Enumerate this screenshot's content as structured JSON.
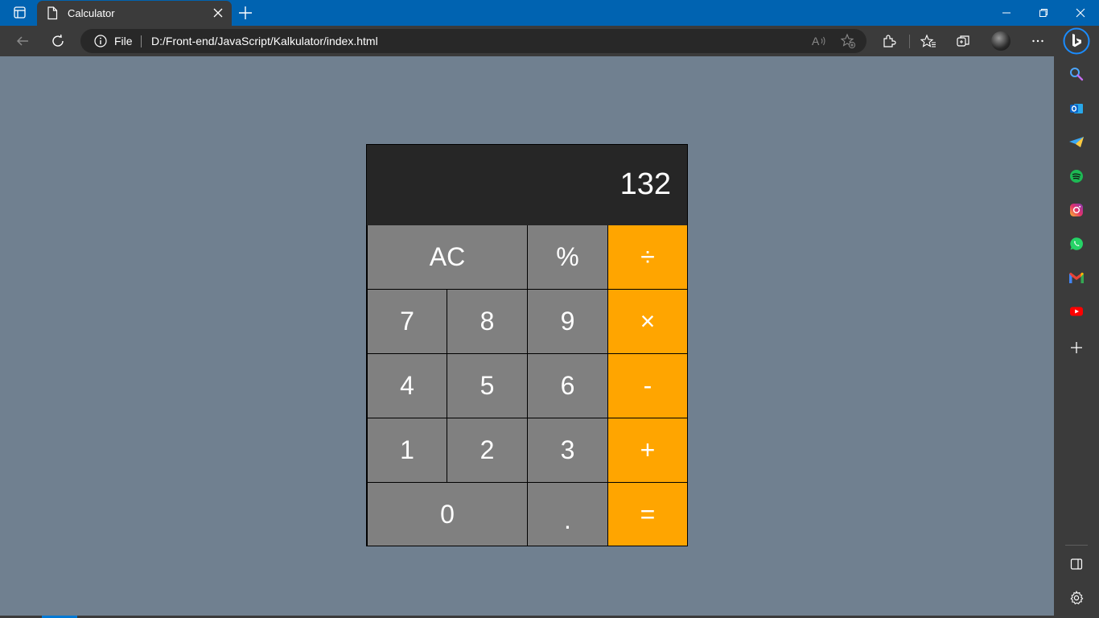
{
  "browser": {
    "tab_title": "Calculator",
    "address": {
      "scheme_label": "File",
      "url": "D:/Front-end/JavaScript/Kalkulator/index.html"
    }
  },
  "calculator": {
    "display_value": "132",
    "keys": {
      "clear": "AC",
      "percent": "%",
      "divide": "÷",
      "seven": "7",
      "eight": "8",
      "nine": "9",
      "multiply": "×",
      "four": "4",
      "five": "5",
      "six": "6",
      "subtract": "-",
      "one": "1",
      "two": "2",
      "three": "3",
      "add": "+",
      "zero": "0",
      "decimal": ".",
      "equals": "="
    }
  },
  "colors": {
    "page_background": "#708090",
    "display_background": "#262626",
    "number_key": "#808080",
    "operator_key": "#ffa500",
    "browser_titlebar": "#0063b1",
    "browser_chrome": "#3b3b3b"
  },
  "sidebar_icons": [
    "search-icon",
    "outlook-icon",
    "telegram-icon",
    "spotify-icon",
    "instagram-icon",
    "whatsapp-icon",
    "gmail-icon",
    "youtube-icon",
    "add-icon",
    "sidebar-toggle-icon",
    "settings-icon"
  ]
}
